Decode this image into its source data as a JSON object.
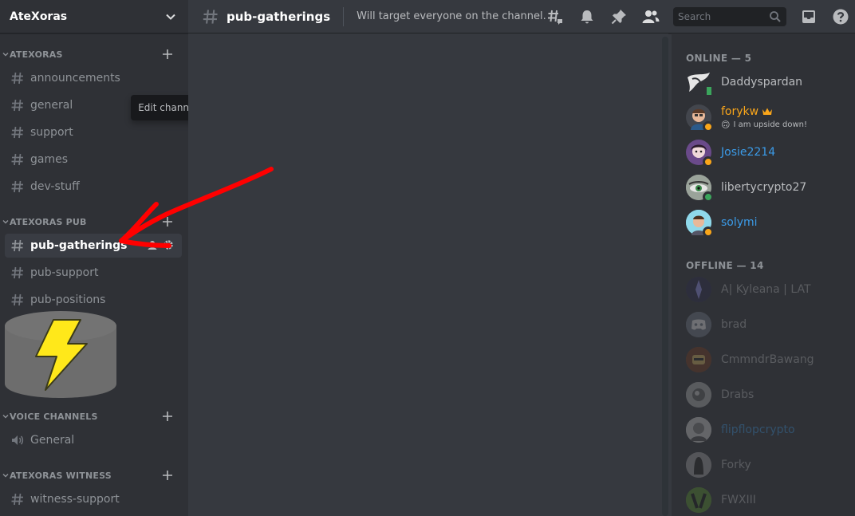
{
  "guild": {
    "name": "AteXoras"
  },
  "tooltip": {
    "text": "Edit channel"
  },
  "categories": [
    {
      "label": "ATEXORAS"
    },
    {
      "label": "ATEXORAS PUB"
    },
    {
      "label": "VOICE CHANNELS"
    },
    {
      "label": "ATEXORAS WITNESS"
    }
  ],
  "channels": [
    {
      "name": "announcements",
      "type": "text"
    },
    {
      "name": "general",
      "type": "text"
    },
    {
      "name": "support",
      "type": "text"
    },
    {
      "name": "games",
      "type": "text"
    },
    {
      "name": "dev-stuff",
      "type": "text"
    },
    {
      "name": "pub-gatherings",
      "type": "text",
      "selected": true
    },
    {
      "name": "pub-support",
      "type": "text"
    },
    {
      "name": "pub-positions",
      "type": "text"
    },
    {
      "name": "General",
      "type": "voice"
    },
    {
      "name": "witness-support",
      "type": "text"
    }
  ],
  "header": {
    "channel": "pub-gatherings",
    "topic": "Will target everyone on the channel. If ...",
    "search_placeholder": "Search"
  },
  "members": {
    "online_header": "ONLINE — 5",
    "offline_header": "OFFLINE — 14",
    "online": [
      {
        "name": "Daddyspardan",
        "color": "#b9bbbe",
        "status": "mobile"
      },
      {
        "name": "forykw",
        "color": "#faa61a",
        "status": "idle",
        "owner": true,
        "custom_status": "I am upside down!",
        "custom_emoji": "🙃"
      },
      {
        "name": "Josie2214",
        "color": "#3b9be8",
        "status": "idle"
      },
      {
        "name": "libertycrypto27",
        "color": "#b9bbbe",
        "status": "online"
      },
      {
        "name": "solymi",
        "color": "#3b9be8",
        "status": "idle"
      }
    ],
    "offline": [
      {
        "name": "A| Kyleana | LAT",
        "color": "#b9bbbe"
      },
      {
        "name": "brad",
        "color": "#b9bbbe"
      },
      {
        "name": "CmmndrBawang",
        "color": "#b9bbbe"
      },
      {
        "name": "Drabs",
        "color": "#b9bbbe"
      },
      {
        "name": "flipflopcrypto",
        "color": "#3b9be8"
      },
      {
        "name": "Forky",
        "color": "#b9bbbe"
      },
      {
        "name": "FWXIII",
        "color": "#b9bbbe"
      }
    ]
  },
  "colors": {
    "accent": "#5865f2",
    "online": "#3ba55c",
    "idle": "#faa61a",
    "arrow": "#ff0000"
  }
}
